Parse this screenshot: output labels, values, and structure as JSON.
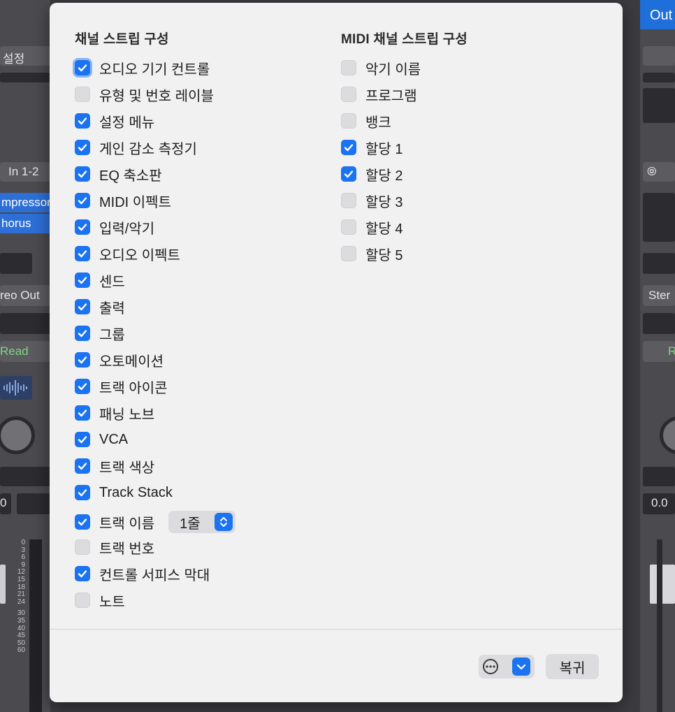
{
  "background": {
    "left_strip": {
      "settings": "설정",
      "input": "In 1-2",
      "plugins": [
        "mpressor",
        "horus"
      ],
      "output": "reo Out",
      "automation": "Read",
      "fader_value": "0"
    },
    "right_strip": {
      "output_tab": "Out",
      "output": "Ster",
      "automation": "R",
      "fader_value": "0.0"
    },
    "meter_scale": [
      "0",
      "3",
      "6",
      "9",
      "12",
      "15",
      "18",
      "21",
      "24",
      "30",
      "35",
      "40",
      "45",
      "50",
      "60"
    ],
    "bottom_scale_label": "60"
  },
  "dialog": {
    "channel_strip": {
      "title": "채널 스트립 구성",
      "items": [
        {
          "label": "오디오 기기 컨트롤",
          "checked": true
        },
        {
          "label": "유형 및 번호 레이블",
          "checked": false
        },
        {
          "label": "설정 메뉴",
          "checked": true
        },
        {
          "label": "게인 감소 측정기",
          "checked": true
        },
        {
          "label": "EQ 축소판",
          "checked": true
        },
        {
          "label": "MIDI 이펙트",
          "checked": true
        },
        {
          "label": "입력/악기",
          "checked": true
        },
        {
          "label": "오디오 이펙트",
          "checked": true
        },
        {
          "label": "센드",
          "checked": true
        },
        {
          "label": "출력",
          "checked": true
        },
        {
          "label": "그룹",
          "checked": true
        },
        {
          "label": "오토메이션",
          "checked": true
        },
        {
          "label": "트랙 아이콘",
          "checked": true
        },
        {
          "label": "패닝 노브",
          "checked": true
        },
        {
          "label": "VCA",
          "checked": true
        },
        {
          "label": "트랙 색상",
          "checked": true
        },
        {
          "label": "Track Stack",
          "checked": true
        },
        {
          "label": "트랙 이름",
          "checked": true
        },
        {
          "label": "트랙 번호",
          "checked": false
        },
        {
          "label": "컨트롤 서피스 막대",
          "checked": true
        },
        {
          "label": "노트",
          "checked": false
        }
      ],
      "track_name_lines": "1줄"
    },
    "midi_strip": {
      "title": "MIDI 채널 스트립 구성",
      "items": [
        {
          "label": "악기 이름",
          "checked": false
        },
        {
          "label": "프로그램",
          "checked": false
        },
        {
          "label": "뱅크",
          "checked": false
        },
        {
          "label": "할당 1",
          "checked": true
        },
        {
          "label": "할당 2",
          "checked": true
        },
        {
          "label": "할당 3",
          "checked": false
        },
        {
          "label": "할당 4",
          "checked": false
        },
        {
          "label": "할당 5",
          "checked": false
        }
      ]
    },
    "revert_label": "복귀",
    "colors": {
      "accent": "#1b73f2",
      "dialog_bg": "#f1f1f2"
    }
  }
}
